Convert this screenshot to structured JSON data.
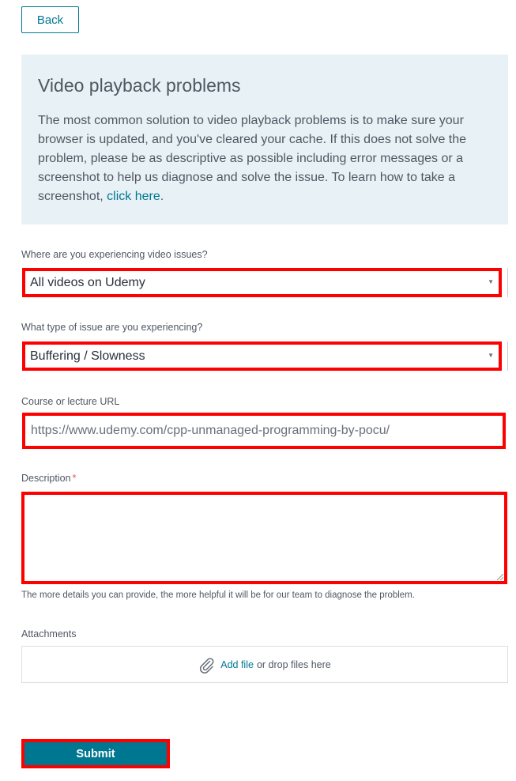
{
  "back_button": {
    "label": "Back"
  },
  "info": {
    "title": "Video playback problems",
    "text": "The most common solution to video playback problems is to make sure your browser is updated, and you've cleared your cache. If this does not solve the problem, please be as descriptive as possible including error messages or a screenshot to help us diagnose and solve the issue. To learn how to take a screenshot, ",
    "link_text": "click here",
    "text_end": "."
  },
  "fields": {
    "location": {
      "label": "Where are you experiencing video issues?",
      "value": "All videos on Udemy"
    },
    "issue_type": {
      "label": "What type of issue are you experiencing?",
      "value": "Buffering / Slowness"
    },
    "url": {
      "label": "Course or lecture URL",
      "value": "https://www.udemy.com/cpp-unmanaged-programming-by-pocu/"
    },
    "description": {
      "label": "Description",
      "required_mark": "*",
      "value": "",
      "helper": "The more details you can provide, the more helpful it will be for our team to diagnose the problem."
    },
    "attachments": {
      "label": "Attachments",
      "add_file": "Add file",
      "drop_text": "or drop files here"
    }
  },
  "submit": {
    "label": "Submit"
  },
  "colors": {
    "accent": "#007791",
    "highlight": "#ff0000",
    "info_bg": "#e8f1f5",
    "required": "#ec5252"
  },
  "icons": {
    "attach": "paperclip-icon",
    "select_arrow": "triangle-down-icon"
  }
}
